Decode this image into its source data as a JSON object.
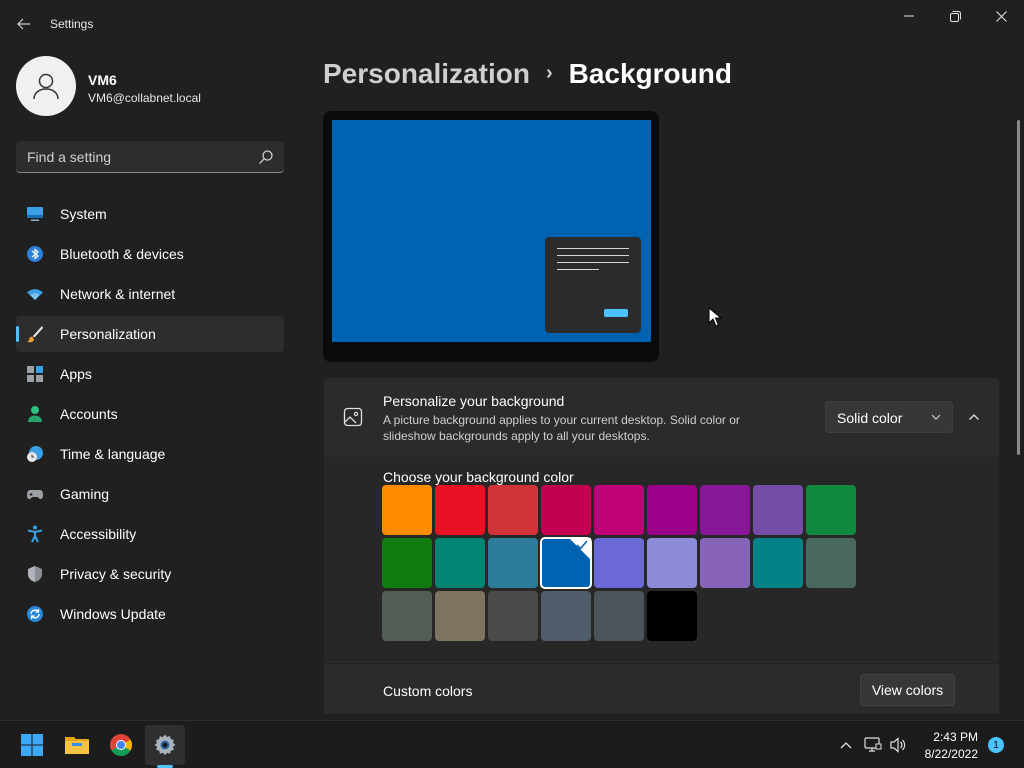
{
  "window": {
    "title": "Settings",
    "back_icon": "arrow-left-icon",
    "controls": [
      "minimize-icon",
      "maximize-icon",
      "close-icon"
    ]
  },
  "profile": {
    "name": "VM6",
    "email": "VM6@collabnet.local"
  },
  "search": {
    "placeholder": "Find a setting"
  },
  "sidebar": {
    "active": "Personalization",
    "items": [
      {
        "label": "System",
        "icon": "monitor-icon"
      },
      {
        "label": "Bluetooth & devices",
        "icon": "bluetooth-icon"
      },
      {
        "label": "Network & internet",
        "icon": "wifi-icon"
      },
      {
        "label": "Personalization",
        "icon": "paintbrush-icon"
      },
      {
        "label": "Apps",
        "icon": "apps-icon"
      },
      {
        "label": "Accounts",
        "icon": "person-icon"
      },
      {
        "label": "Time & language",
        "icon": "clock-globe-icon"
      },
      {
        "label": "Gaming",
        "icon": "gamepad-icon"
      },
      {
        "label": "Accessibility",
        "icon": "accessibility-icon"
      },
      {
        "label": "Privacy & security",
        "icon": "shield-icon"
      },
      {
        "label": "Windows Update",
        "icon": "update-icon"
      }
    ]
  },
  "breadcrumb": {
    "parent": "Personalization",
    "separator": "›",
    "current": "Background"
  },
  "preview": {
    "background_color": "#0063b1"
  },
  "background_card": {
    "title": "Personalize your background",
    "description": "A picture background applies to your current desktop. Solid color or slideshow backgrounds apply to all your desktops.",
    "dropdown_value": "Solid color",
    "icon": "image-icon",
    "color_heading": "Choose your background color",
    "selected_color": "#0063b1",
    "colors": [
      "#ff8c00",
      "#e81123",
      "#d13438",
      "#c30052",
      "#bf0077",
      "#9a0089",
      "#881798",
      "#744da9",
      "#10893e",
      "#107c10",
      "#018574",
      "#2d7d9a",
      "#0063b1",
      "#6b69d6",
      "#8e8cd8",
      "#8764b8",
      "#038387",
      "#486860",
      "#525e54",
      "#7e735f",
      "#4c4a48",
      "#515c6b",
      "#4a5459",
      "#000000"
    ]
  },
  "custom_colors": {
    "label": "Custom colors",
    "button_label": "View colors"
  },
  "taskbar": {
    "apps": [
      "windows-start-icon",
      "file-explorer-icon",
      "chrome-icon",
      "settings-gear-icon"
    ],
    "tray": [
      "chevron-up-icon",
      "network-icon",
      "volume-icon"
    ],
    "time": "2:43 PM",
    "date": "8/22/2022",
    "notifications": "1"
  }
}
